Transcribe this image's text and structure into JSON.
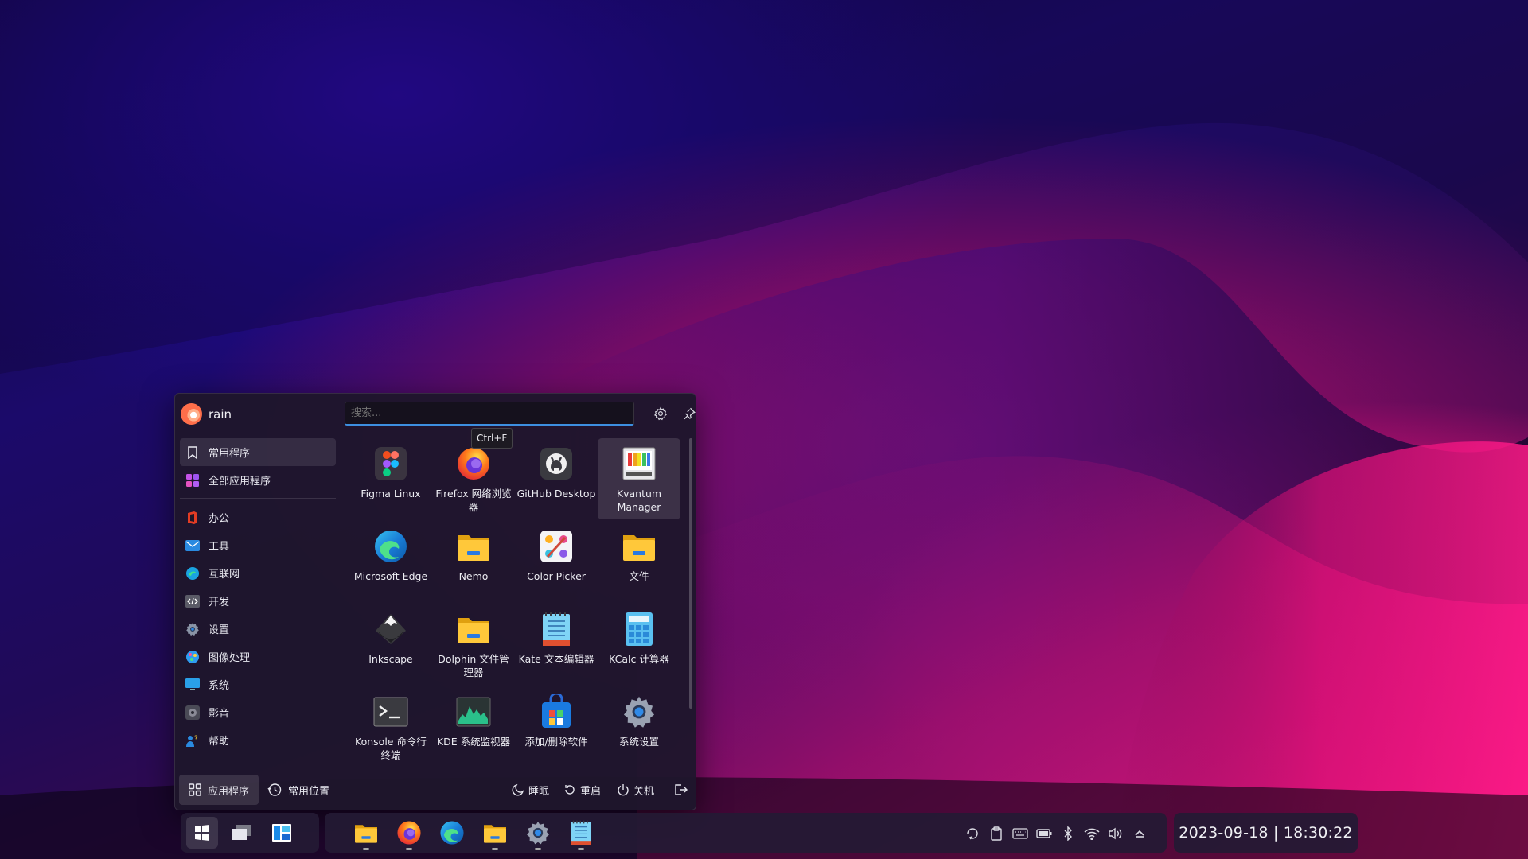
{
  "menu": {
    "user_name": "rain",
    "search_placeholder": "搜索...",
    "tooltip": "Ctrl+F",
    "sidebar": {
      "favorites": "常用程序",
      "all_apps": "全部应用程序",
      "categories": [
        "办公",
        "工具",
        "互联网",
        "开发",
        "设置",
        "图像处理",
        "系统",
        "影音",
        "帮助"
      ]
    },
    "apps": [
      {
        "name": "Figma Linux",
        "icon": "figma-icon"
      },
      {
        "name": "Firefox 网络浏览器",
        "icon": "firefox-icon"
      },
      {
        "name": "GitHub Desktop",
        "icon": "github-icon"
      },
      {
        "name": "Kvantum Manager",
        "icon": "kvantum-icon"
      },
      {
        "name": "Microsoft Edge",
        "icon": "edge-icon"
      },
      {
        "name": "Nemo",
        "icon": "folder-icon"
      },
      {
        "name": "Color Picker",
        "icon": "color-picker-icon"
      },
      {
        "name": "文件",
        "icon": "folder-icon"
      },
      {
        "name": "Inkscape",
        "icon": "inkscape-icon"
      },
      {
        "name": "Dolphin 文件管理器",
        "icon": "folder-icon"
      },
      {
        "name": "Kate 文本编辑器",
        "icon": "notepad-icon"
      },
      {
        "name": "KCalc 计算器",
        "icon": "calculator-icon"
      },
      {
        "name": "Konsole 命令行终端",
        "icon": "terminal-icon"
      },
      {
        "name": "KDE 系统监视器",
        "icon": "system-monitor-icon"
      },
      {
        "name": "添加/删除软件",
        "icon": "software-store-icon"
      },
      {
        "name": "系统设置",
        "icon": "settings-gear-icon"
      }
    ],
    "footer": {
      "applications": "应用程序",
      "places": "常用位置",
      "sleep": "睡眠",
      "restart": "重启",
      "shutdown": "关机"
    }
  },
  "taskbar": {
    "clock": "2023-09-18 | 18:30:22"
  }
}
